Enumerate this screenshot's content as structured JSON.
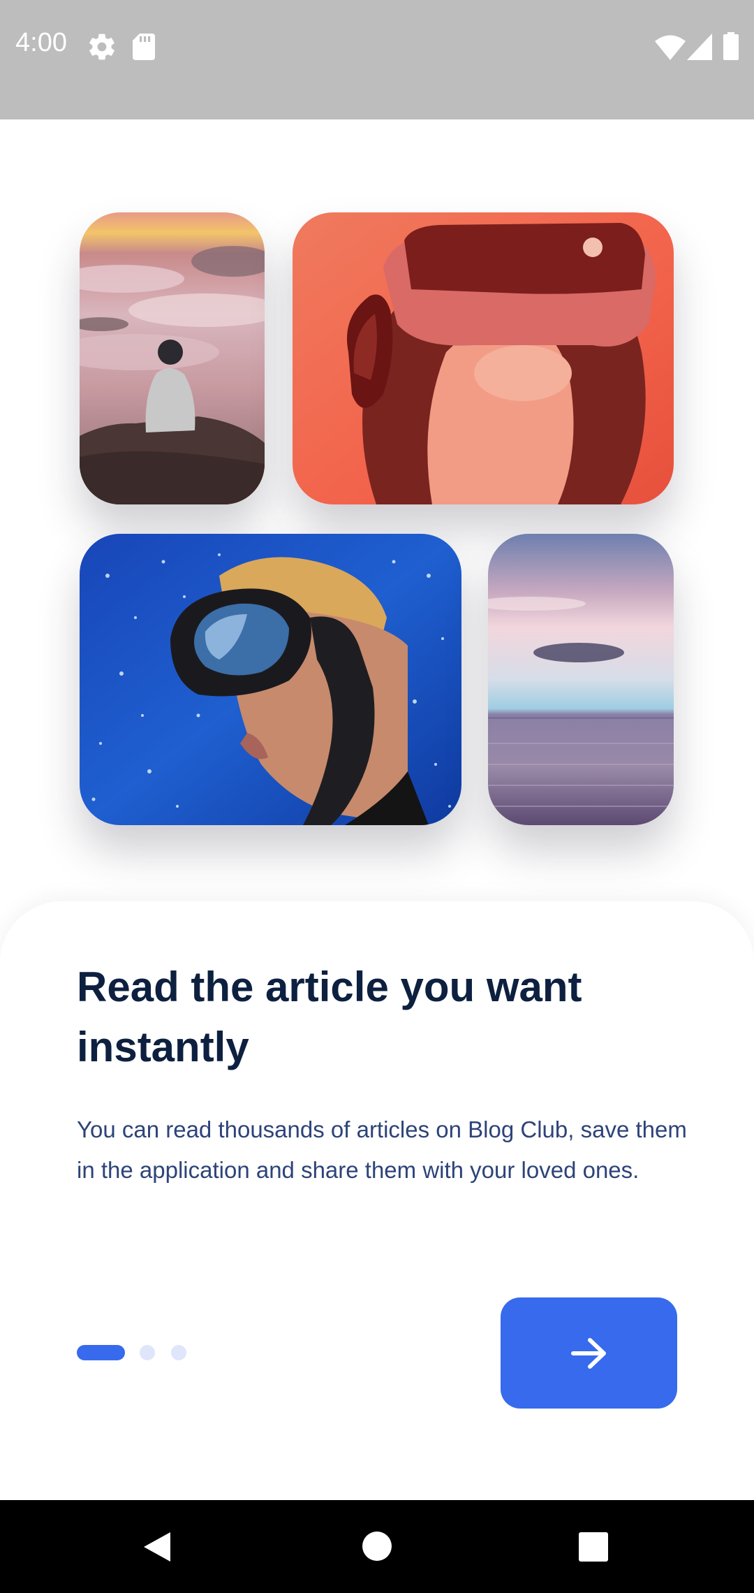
{
  "status_bar": {
    "time": "4:00",
    "icons": [
      "gear-icon",
      "sd-card-icon",
      "wifi-icon",
      "signal-icon",
      "battery-icon"
    ]
  },
  "hero": {
    "images": [
      "person-on-mountain-photo",
      "vr-headset-photo",
      "scuba-diver-photo",
      "sea-horizon-photo"
    ]
  },
  "onboarding": {
    "title": "Read the article you want instantly",
    "description": "You can read thousands of articles on Blog Club, save them in the application and share them with your loved ones.",
    "page_indicator": {
      "current": 1,
      "total": 3
    },
    "next_button_icon": "arrow-right-icon"
  },
  "colors": {
    "primary": "#376aed",
    "title": "#0d2040",
    "body": "#2d4379",
    "indicator_inactive": "#dfe6fb",
    "status_bar": "#bdbdbd",
    "nav_bar": "#000000"
  },
  "nav_bar": {
    "icons": [
      "back-icon",
      "home-icon",
      "recents-icon"
    ]
  }
}
